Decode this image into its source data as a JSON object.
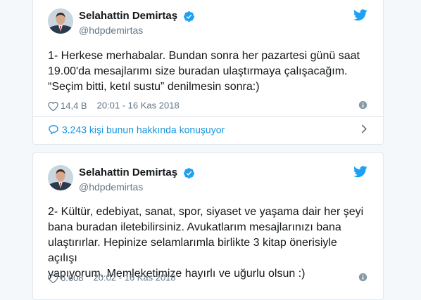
{
  "tweets": [
    {
      "display_name": "Selahattin Demirtaş",
      "handle": "@hdpdemirtas",
      "text_lines": [
        "1- Herkese merhabalar. Bundan sonra her pazartesi günü saat",
        "19.00'da mesajlarımı size buradan ulaştırmaya çalışacağım.",
        "“Seçim bitti, ketıl sustu” denilmesin sonra:)"
      ],
      "likes": "14,4 B",
      "timestamp": "20:01 - 16 Kas 2018",
      "conversation": "3.243 kişi bunun hakkında konuşuyor"
    },
    {
      "display_name": "Selahattin Demirtaş",
      "handle": "@hdpdemirtas",
      "text_lines": [
        "2- Kültür, edebiyat, sanat, spor, siyaset ve yaşama dair her şeyi",
        "bana buradan iletebilirsiniz. Avukatlarım mesajlarınızı bana",
        "ulaştırırlar. Hepinize selamlarımla birlikte 3 kitap önerisiyle açılışı",
        "yapıyorum. Memleketimize hayırlı ve uğurlu olsun :)"
      ],
      "likes": "6.608",
      "timestamp": "20:02 - 16 Kas 2018"
    }
  ],
  "icons": {
    "verified": "verified-badge-icon",
    "bird": "twitter-bird-icon",
    "heart": "heart-icon",
    "info": "info-icon",
    "conversation": "speech-bubble-icon",
    "chevron": "chevron-right-icon"
  },
  "colors": {
    "accent": "#1da1f2",
    "link": "#1b95e0",
    "muted": "#657786",
    "text": "#14171a",
    "border": "#e1e8ed",
    "background": "#f5f8fa"
  }
}
